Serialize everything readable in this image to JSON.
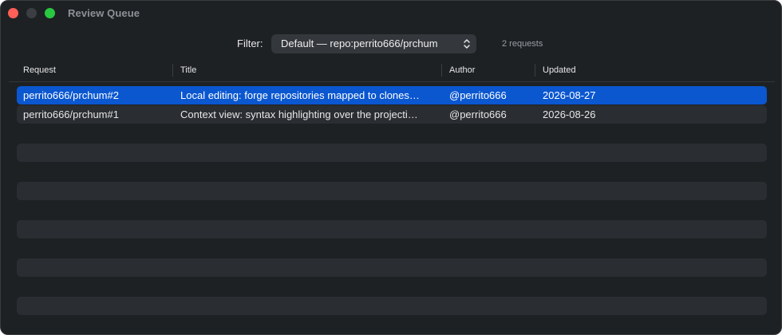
{
  "window": {
    "title": "Review Queue"
  },
  "filter": {
    "label": "Filter:",
    "selected": "Default — repo:perrito666/prchum",
    "count_text": "2 requests"
  },
  "table": {
    "columns": [
      "Request",
      "Title",
      "Author",
      "Updated"
    ],
    "rows": [
      {
        "request": "perrito666/prchum#2",
        "title": "Local editing: forge repositories mapped to clones…",
        "author": "@perrito666",
        "updated": "2026-08-27",
        "selected": true
      },
      {
        "request": "perrito666/prchum#1",
        "title": "Context view: syntax highlighting over the projecti…",
        "author": "@perrito666",
        "updated": "2026-08-26",
        "selected": false
      }
    ]
  },
  "colors": {
    "window_bg": "#1e2124",
    "selection": "#0a57d0",
    "alt_row": "#2a2d31",
    "close": "#ff5f57",
    "zoom": "#28c840"
  },
  "icons": {
    "select_chevron": "chevron-up-down-icon"
  }
}
